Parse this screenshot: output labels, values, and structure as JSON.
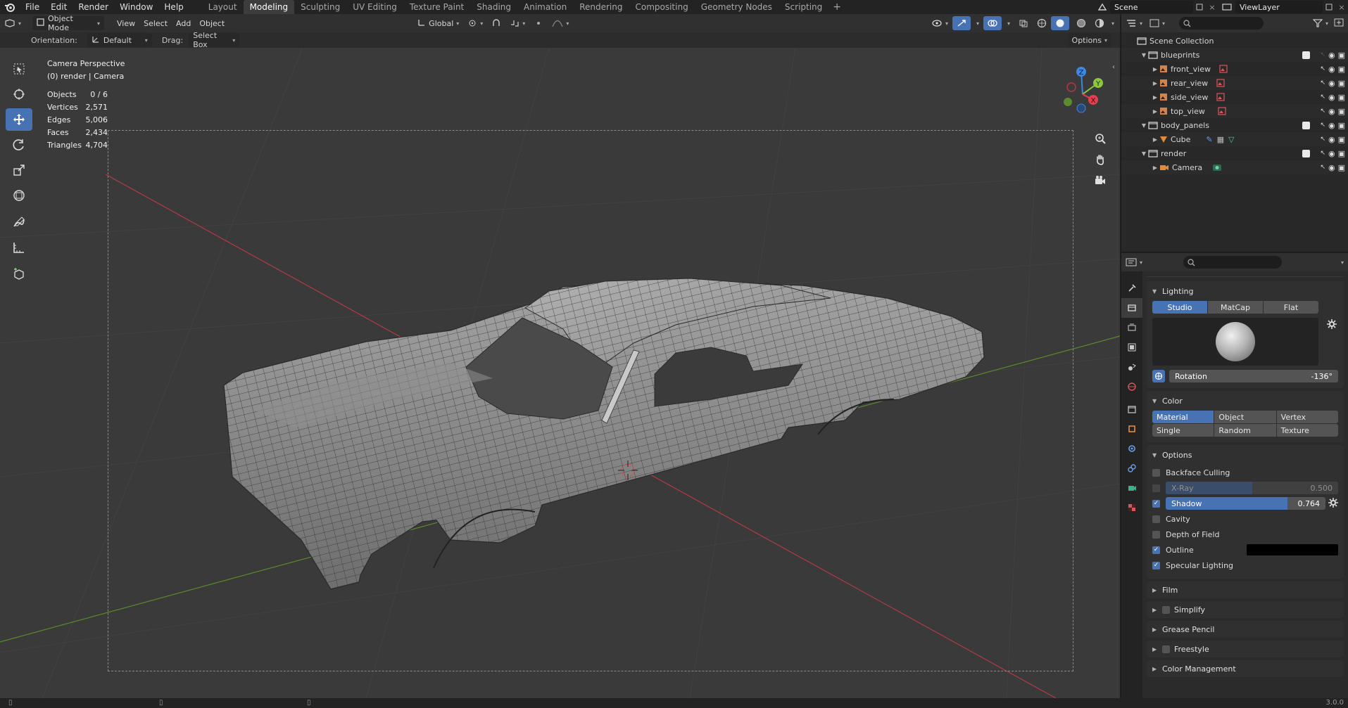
{
  "topbar": {
    "menus": [
      "File",
      "Edit",
      "Render",
      "Window",
      "Help"
    ],
    "workspaces": [
      "Layout",
      "Modeling",
      "Sculpting",
      "UV Editing",
      "Texture Paint",
      "Shading",
      "Animation",
      "Rendering",
      "Compositing",
      "Geometry Nodes",
      "Scripting"
    ],
    "active_workspace": "Modeling",
    "scene_name": "Scene",
    "view_layer": "ViewLayer"
  },
  "viewport_header": {
    "mode": "Object Mode",
    "menus": [
      "View",
      "Select",
      "Add",
      "Object"
    ],
    "transform_orientation": "Global"
  },
  "tool_header": {
    "orientation_label": "Orientation:",
    "orientation_value": "Default",
    "drag_label": "Drag:",
    "drag_value": "Select Box",
    "options_label": "Options"
  },
  "viewport_overlay": {
    "view_name": "Camera Perspective",
    "context": "(0) render | Camera"
  },
  "stats": [
    {
      "label": "Objects",
      "value": "0 / 6"
    },
    {
      "label": "Vertices",
      "value": "2,571"
    },
    {
      "label": "Edges",
      "value": "5,006"
    },
    {
      "label": "Faces",
      "value": "2,434"
    },
    {
      "label": "Triangles",
      "value": "4,704"
    }
  ],
  "gizmo": {
    "x_label": "X",
    "y_label": "Y",
    "z_label": "Z"
  },
  "outliner": {
    "root": "Scene Collection",
    "rows": [
      {
        "label": "blueprints"
      },
      {
        "label": "front_view"
      },
      {
        "label": "rear_view"
      },
      {
        "label": "side_view"
      },
      {
        "label": "top_view"
      },
      {
        "label": "body_panels"
      },
      {
        "label": "Cube"
      },
      {
        "label": "render"
      },
      {
        "label": "Camera"
      }
    ]
  },
  "properties": {
    "lighting": {
      "title": "Lighting",
      "modes": [
        "Studio",
        "MatCap",
        "Flat"
      ],
      "active_mode": "Studio",
      "rotation_label": "Rotation",
      "rotation_value": "-136°"
    },
    "color": {
      "title": "Color",
      "options_row1": [
        "Material",
        "Object",
        "Vertex"
      ],
      "options_row2": [
        "Single",
        "Random",
        "Texture"
      ],
      "active": "Material"
    },
    "options": {
      "title": "Options",
      "backface_culling": "Backface Culling",
      "xray_label": "X-Ray",
      "xray_value": "0.500",
      "xray_fraction": 0.5,
      "shadow_label": "Shadow",
      "shadow_value": "0.764",
      "shadow_fraction": 0.764,
      "cavity": "Cavity",
      "depth_of_field": "Depth of Field",
      "outline": "Outline",
      "specular": "Specular Lighting"
    },
    "collapsed_panels": [
      "Film",
      "Simplify",
      "Grease Pencil",
      "Freestyle",
      "Color Management"
    ]
  },
  "status": {
    "version": "3.0.0"
  },
  "colors": {
    "accent": "#4772b3",
    "x_axis": "#e0414e",
    "y_axis": "#8cc63f",
    "z_axis": "#3f88e0",
    "viewport_bg": "#3a3a3a"
  }
}
